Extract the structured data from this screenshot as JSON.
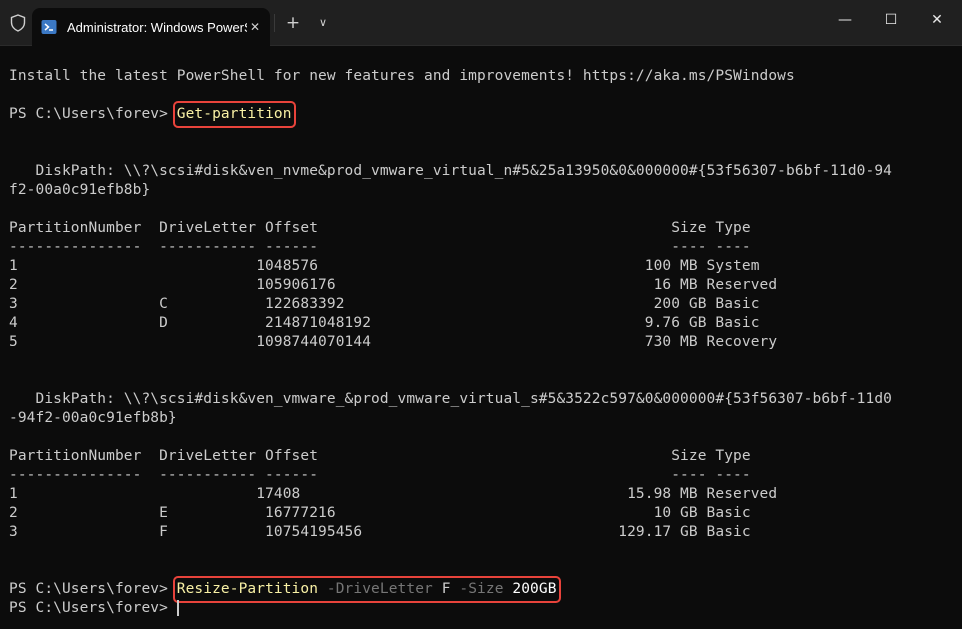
{
  "window": {
    "tab_title": "Administrator: Windows PowerShell",
    "tab_close_glyph": "✕",
    "new_tab_glyph": "+",
    "dropdown_glyph": "∨",
    "min_glyph": "—",
    "max_glyph": "☐",
    "close_glyph": "✕",
    "shield_icon": "shield-icon",
    "powershell_icon": "powershell-icon"
  },
  "colors": {
    "background": "#0c0c0c",
    "text": "#cccccc",
    "command": "#f9f1a5",
    "parameter": "#767676",
    "highlight_box": "#e8433b"
  },
  "terminal": {
    "install_line": "Install the latest PowerShell for new features and improvements! https://aka.ms/PSWindows",
    "prompt1": "PS C:\\Users\\forev> ",
    "cmd1": "Get-partition",
    "disk1": {
      "path_line1": "   DiskPath: \\\\?\\scsi#disk&ven_nvme&prod_vmware_virtual_n#5&25a13950&0&000000#{53f56307-b6bf-11d0-94",
      "path_line2": "f2-00a0c91efb8b}",
      "header": "PartitionNumber  DriveLetter Offset                                        Size Type",
      "divider": "---------------  ----------- ------                                        ---- ----",
      "rows": [
        "1                           1048576                                     100 MB System",
        "2                           105906176                                    16 MB Reserved",
        "3                C           122683392                                   200 GB Basic",
        "4                D           214871048192                               9.76 GB Basic",
        "5                           1098744070144                               730 MB Recovery"
      ]
    },
    "disk2": {
      "path_line1": "   DiskPath: \\\\?\\scsi#disk&ven_vmware_&prod_vmware_virtual_s#5&3522c597&0&000000#{53f56307-b6bf-11d0",
      "path_line2": "-94f2-00a0c91efb8b}",
      "header": "PartitionNumber  DriveLetter Offset                                        Size Type",
      "divider": "---------------  ----------- ------                                        ---- ----",
      "rows": [
        "1                           17408                                     15.98 MB Reserved",
        "2                E           16777216                                    10 GB Basic",
        "3                F           10754195456                             129.17 GB Basic"
      ]
    },
    "prompt2": "PS C:\\Users\\forev> ",
    "cmd2": {
      "name": "Resize-Partition",
      "param1": "-DriveLetter",
      "value1": "F",
      "param2": "-Size",
      "value2": "200GB"
    },
    "prompt3": "PS C:\\Users\\forev> "
  }
}
